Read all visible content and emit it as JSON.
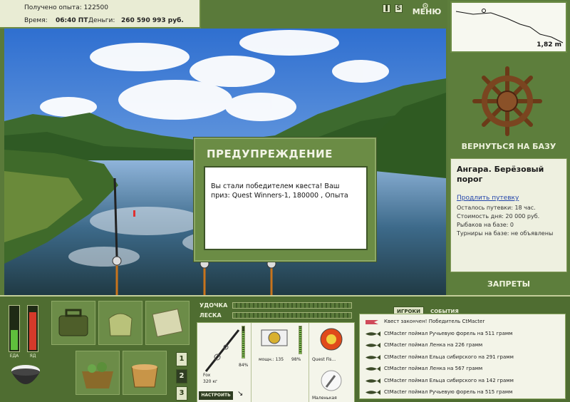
{
  "info": {
    "exp_label": "Получено опыта:",
    "exp_value": "122500",
    "time_label": "Время:",
    "time_value": "06:40 ПТ",
    "money_label": "Деньги:",
    "money_value": "260 590 993 руб."
  },
  "topbar": {
    "pause_icon": "pause-icon",
    "s_label": "S",
    "menu_label": "МЕНЮ"
  },
  "depth": {
    "value": "1,82 m"
  },
  "right": {
    "return_label": "ВЕРНУТЬСЯ НА БАЗУ",
    "location_title": "Ангара. Берёзовый порог",
    "extend_link": "Продлить путевку",
    "trip_left": "Осталось путевки: 18 час.",
    "day_cost": "Стоимость дня: 20 000 руб.",
    "anglers": "Рыбаков на базе: 0",
    "tournaments": "Турниры на базе: не объявлены",
    "bans_label": "ЗАПРЕТЫ"
  },
  "dialog": {
    "title": "ПРЕДУПРЕЖДЕНИЕ",
    "message": "Вы стали победителем квеста! Ваш приз: Quest Winners-1, 180000 , Опыта"
  },
  "status": {
    "food_label": "ЕДА",
    "poison_label": "ЯД",
    "food_level": 0.45,
    "poison_level": 0.85
  },
  "pages": [
    "1",
    "2",
    "3"
  ],
  "active_page": 1,
  "tackle": {
    "rod_label": "УДОЧКА",
    "line_label": "ЛЕСКА",
    "rod_name": "Fox",
    "rod_test": "320 кг",
    "rod_percent": "84%",
    "reel_name": "мощн.: 135",
    "reel_percent": "98%",
    "line_name": "Quest Fis...",
    "bait_name": "Маленькая",
    "setup_label": "НАСТРОИТЬ",
    "rod_level": 0.84,
    "reel_level": 0.98
  },
  "events": {
    "tab_players": "ИГРОКИ",
    "tab_events": "СОБЫТИЯ",
    "items": [
      "Квест закончен! Победитель CtMacter",
      "CtMacter поймал Ручьевую форель на 511 грамм",
      "CtMacter поймал Ленка на 226 грамм",
      "CtMacter поймал Ельца сибирского на 291 грамм",
      "CtMacter поймал Ленка на 567 грамм",
      "CtMacter поймал Ельца сибирского на 142 грамм",
      "CtMacter поймал Ручьевую форель на 515 грамм"
    ]
  },
  "colors": {
    "panel_green": "#5d7e3c",
    "food_green": "#5fbf3c",
    "poison_red": "#d43a2a"
  }
}
